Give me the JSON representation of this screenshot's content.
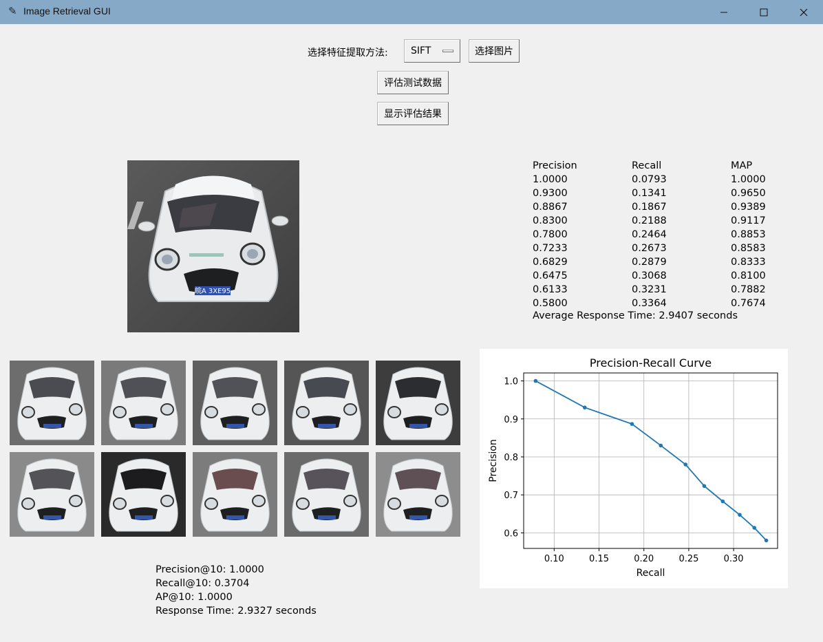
{
  "window": {
    "title": "Image Retrieval GUI",
    "icon": "feather-icon"
  },
  "controls": {
    "method_label": "选择特征提取方法:",
    "method_value": "SIFT",
    "select_image_label": "选择图片",
    "evaluate_label": "评估测试数据",
    "show_results_label": "显示评估结果"
  },
  "query": {
    "plate": "皖A 3XE95"
  },
  "metrics_table": {
    "headers": [
      "Precision",
      "Recall",
      "MAP"
    ],
    "rows": [
      [
        "1.0000",
        "0.0793",
        "1.0000"
      ],
      [
        "0.9300",
        "0.1341",
        "0.9650"
      ],
      [
        "0.8867",
        "0.1867",
        "0.9389"
      ],
      [
        "0.8300",
        "0.2188",
        "0.9117"
      ],
      [
        "0.7800",
        "0.2464",
        "0.8853"
      ],
      [
        "0.7233",
        "0.2673",
        "0.8583"
      ],
      [
        "0.6829",
        "0.2879",
        "0.8333"
      ],
      [
        "0.6475",
        "0.3068",
        "0.8100"
      ],
      [
        "0.6133",
        "0.3231",
        "0.7882"
      ],
      [
        "0.5800",
        "0.3364",
        "0.7674"
      ]
    ],
    "average_response": "Average Response Time: 2.9407 seconds"
  },
  "results": {
    "count": 10,
    "precision_at_10": "Precision@10: 1.0000",
    "recall_at_10": "Recall@10: 0.3704",
    "ap_at_10": "AP@10: 1.0000",
    "response_time": "Response Time: 2.9327 seconds"
  },
  "chart_data": {
    "type": "line",
    "title": "Precision-Recall Curve",
    "xlabel": "Recall",
    "ylabel": "Precision",
    "x": [
      0.0793,
      0.1341,
      0.1867,
      0.2188,
      0.2464,
      0.2673,
      0.2879,
      0.3068,
      0.3231,
      0.3364
    ],
    "y": [
      1.0,
      0.93,
      0.8867,
      0.83,
      0.78,
      0.7233,
      0.6829,
      0.6475,
      0.6133,
      0.58
    ],
    "xlim": [
      0.066,
      0.349
    ],
    "ylim": [
      0.559,
      1.021
    ],
    "xticks": [
      0.1,
      0.15,
      0.2,
      0.25,
      0.3
    ],
    "yticks": [
      0.6,
      0.7,
      0.8,
      0.9,
      1.0
    ],
    "grid": true,
    "color": "#1f77b4"
  }
}
